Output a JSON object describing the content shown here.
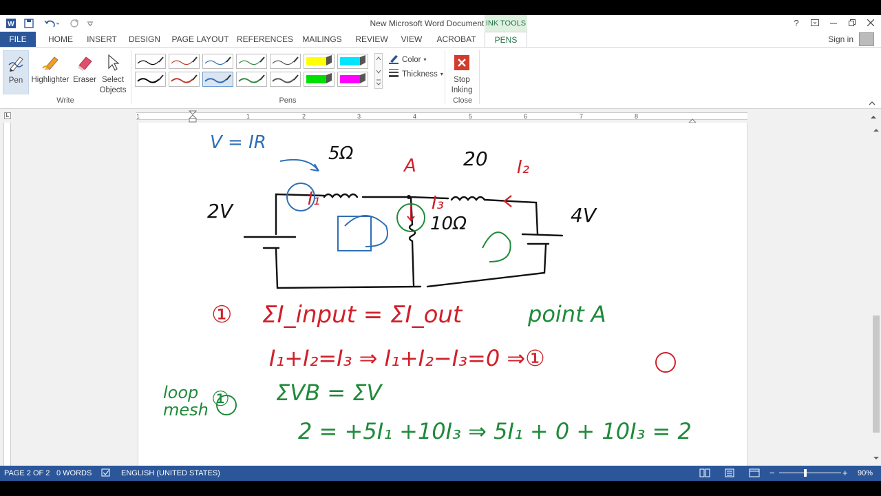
{
  "window": {
    "title": "New Microsoft Word Document - Word",
    "contextual_tab_group": "INK TOOLS",
    "help": "?",
    "sign_in": "Sign in"
  },
  "tabs": [
    {
      "id": "file",
      "label": "FILE"
    },
    {
      "id": "home",
      "label": "HOME"
    },
    {
      "id": "insert",
      "label": "INSERT"
    },
    {
      "id": "design",
      "label": "DESIGN"
    },
    {
      "id": "page-layout",
      "label": "PAGE LAYOUT"
    },
    {
      "id": "references",
      "label": "REFERENCES"
    },
    {
      "id": "mailings",
      "label": "MAILINGS"
    },
    {
      "id": "review",
      "label": "REVIEW"
    },
    {
      "id": "view",
      "label": "VIEW"
    },
    {
      "id": "acrobat",
      "label": "ACROBAT"
    },
    {
      "id": "pens",
      "label": "PENS"
    }
  ],
  "ribbon": {
    "write_group": "Write",
    "pen": "Pen",
    "highlighter": "Highlighter",
    "eraser": "Eraser",
    "select_objects": "Select\nObjects",
    "pens_group": "Pens",
    "color": "Color",
    "thickness": "Thickness",
    "close_group": "Close",
    "stop_inking": "Stop\nInking",
    "pen_swatches": [
      "#000000",
      "#c0392b",
      "#2f6fb5",
      "#2e8b3e",
      "#555555",
      "#ffff00",
      "#00e5ff",
      "#000000",
      "#c0392b",
      "#2f6fb5",
      "#2e8b3e",
      "#555555",
      "#00e000",
      "#ff00ff"
    ]
  },
  "ruler": [
    "1",
    "1",
    "2",
    "3",
    "4",
    "5",
    "6",
    "7",
    "8"
  ],
  "document": {
    "ink_text": {
      "ohm_law": "V = IR",
      "r1": "5Ω",
      "node": "A",
      "r2": "20",
      "i2": "I₂",
      "i1": "I₁",
      "i3": "I₃",
      "src1": "2V",
      "r3": "10Ω",
      "src2": "4V",
      "eq1_num": "①",
      "eq1": "ΣI_input = ΣI_out",
      "eq1_note": "point A",
      "eq2": "I₁+I₂=I₃  ⇒  I₁+I₂−I₃=0  ⇒①",
      "loop_label": "loop\nmesh",
      "eq3_num": "①",
      "eq3": "ΣVB = ΣV",
      "eq4": "2 = +5I₁ +10I₃ ⇒ 5I₁ + 0 + 10I₃ = 2"
    },
    "colors": {
      "blue": "#2f6fb5",
      "red": "#d0202a",
      "green": "#1f8a3a",
      "black": "#111111"
    }
  },
  "status": {
    "page": "PAGE 2 OF 2",
    "words": "0 WORDS",
    "language": "ENGLISH (UNITED STATES)",
    "zoom": "90%"
  }
}
